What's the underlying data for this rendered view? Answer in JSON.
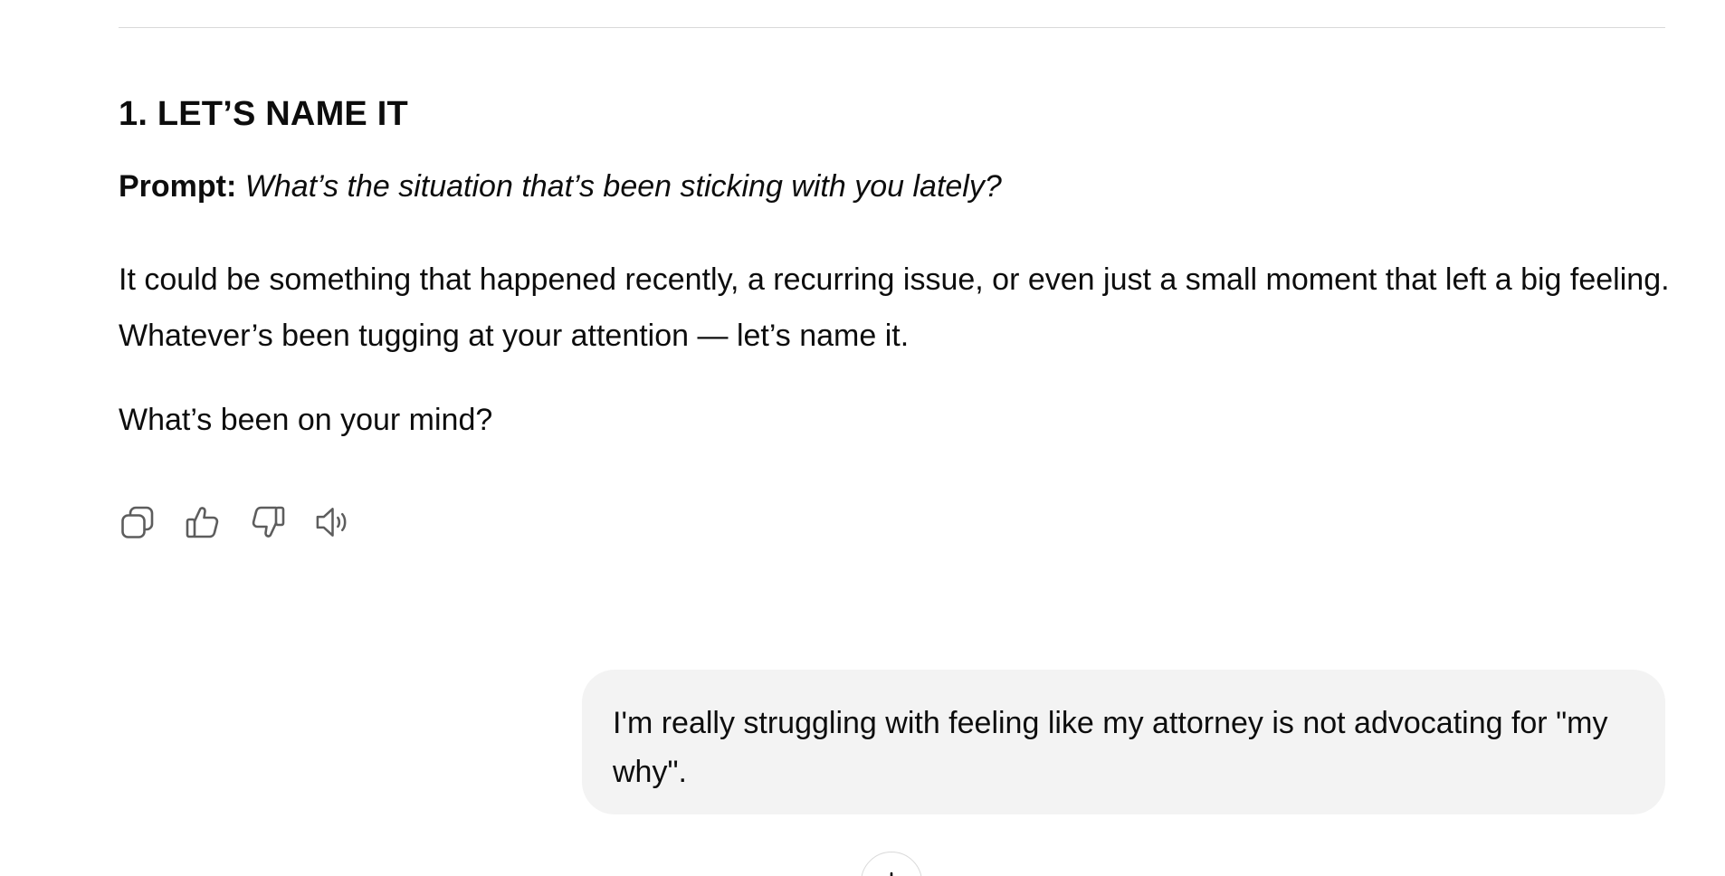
{
  "message": {
    "heading": "1. LET’S NAME IT",
    "prompt_label": "Prompt:",
    "prompt_text": "What’s the situation that’s been sticking with you lately?",
    "body": "It could be something that happened recently, a recurring issue, or even just a small moment that left a big feeling. Whatever’s been tugging at your attention — let’s name it.",
    "question": "What’s been on your mind?"
  },
  "actions": {
    "copy_icon": "copy-icon",
    "like_icon": "thumbs-up-icon",
    "dislike_icon": "thumbs-down-icon",
    "read_aloud_icon": "speaker-icon"
  },
  "user_message": {
    "text": "I'm really struggling with feeling like my attorney is not advocating for \"my why\"."
  },
  "scroll_button": {
    "icon": "arrow-down-icon"
  },
  "colors": {
    "text": "#0d0d0d",
    "bubble_background": "#f3f3f3",
    "divider": "#d9d9d9",
    "icon": "#5d5d5d"
  }
}
